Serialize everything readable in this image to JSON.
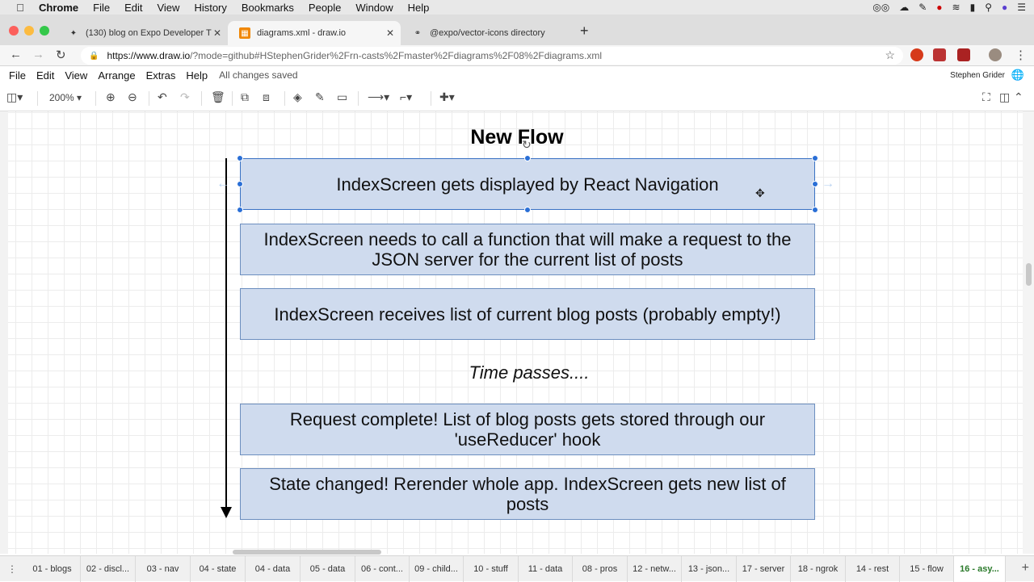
{
  "mac_menu": {
    "apple_icon": "apple-icon",
    "items": [
      "Chrome",
      "File",
      "Edit",
      "View",
      "History",
      "Bookmarks",
      "People",
      "Window",
      "Help"
    ]
  },
  "tabs": [
    {
      "title": "(130) blog on Expo Developer T",
      "favicon": "expo-icon"
    },
    {
      "title": "diagrams.xml - draw.io",
      "favicon": "drawio-icon"
    },
    {
      "title": "@expo/vector-icons directory",
      "favicon": "globe-icon"
    }
  ],
  "address": {
    "host": "https://www.draw.io",
    "path": "/?mode=github#HStephenGrider%2Frn-casts%2Fmaster%2Fdiagrams%2F08%2Fdiagrams.xml"
  },
  "drawio_menu": {
    "items": [
      "File",
      "Edit",
      "View",
      "Arrange",
      "Extras",
      "Help"
    ],
    "status": "All changes saved",
    "user": "Stephen Grider"
  },
  "toolbar": {
    "zoom": "200%"
  },
  "diagram": {
    "title": "New Flow",
    "boxes": [
      "IndexScreen gets displayed by React Navigation",
      "IndexScreen needs to call a function that will make a request to the JSON server for the current list of posts",
      "IndexScreen receives list of current blog posts (probably empty!)",
      "Request complete!  List of blog posts gets stored through our 'useReducer' hook",
      "State changed!  Rerender whole app.  IndexScreen gets new list of posts"
    ],
    "time_label": "Time passes...."
  },
  "pages": [
    "01 - blogs",
    "02 - discl...",
    "03 - nav",
    "04 - state",
    "04 - data",
    "05 - data",
    "06 - cont...",
    "09 - child...",
    "10 - stuff",
    "11 - data",
    "08 - pros",
    "12 - netw...",
    "13 - json...",
    "17 - server",
    "18 - ngrok",
    "14 - rest",
    "15 - flow",
    "16 - asy..."
  ],
  "active_page_index": 17,
  "colors": {
    "box_fill": "#cfdbee",
    "box_border": "#6c8ebf",
    "selection": "#2a6fd6",
    "active_page": "#2b7a2b"
  }
}
